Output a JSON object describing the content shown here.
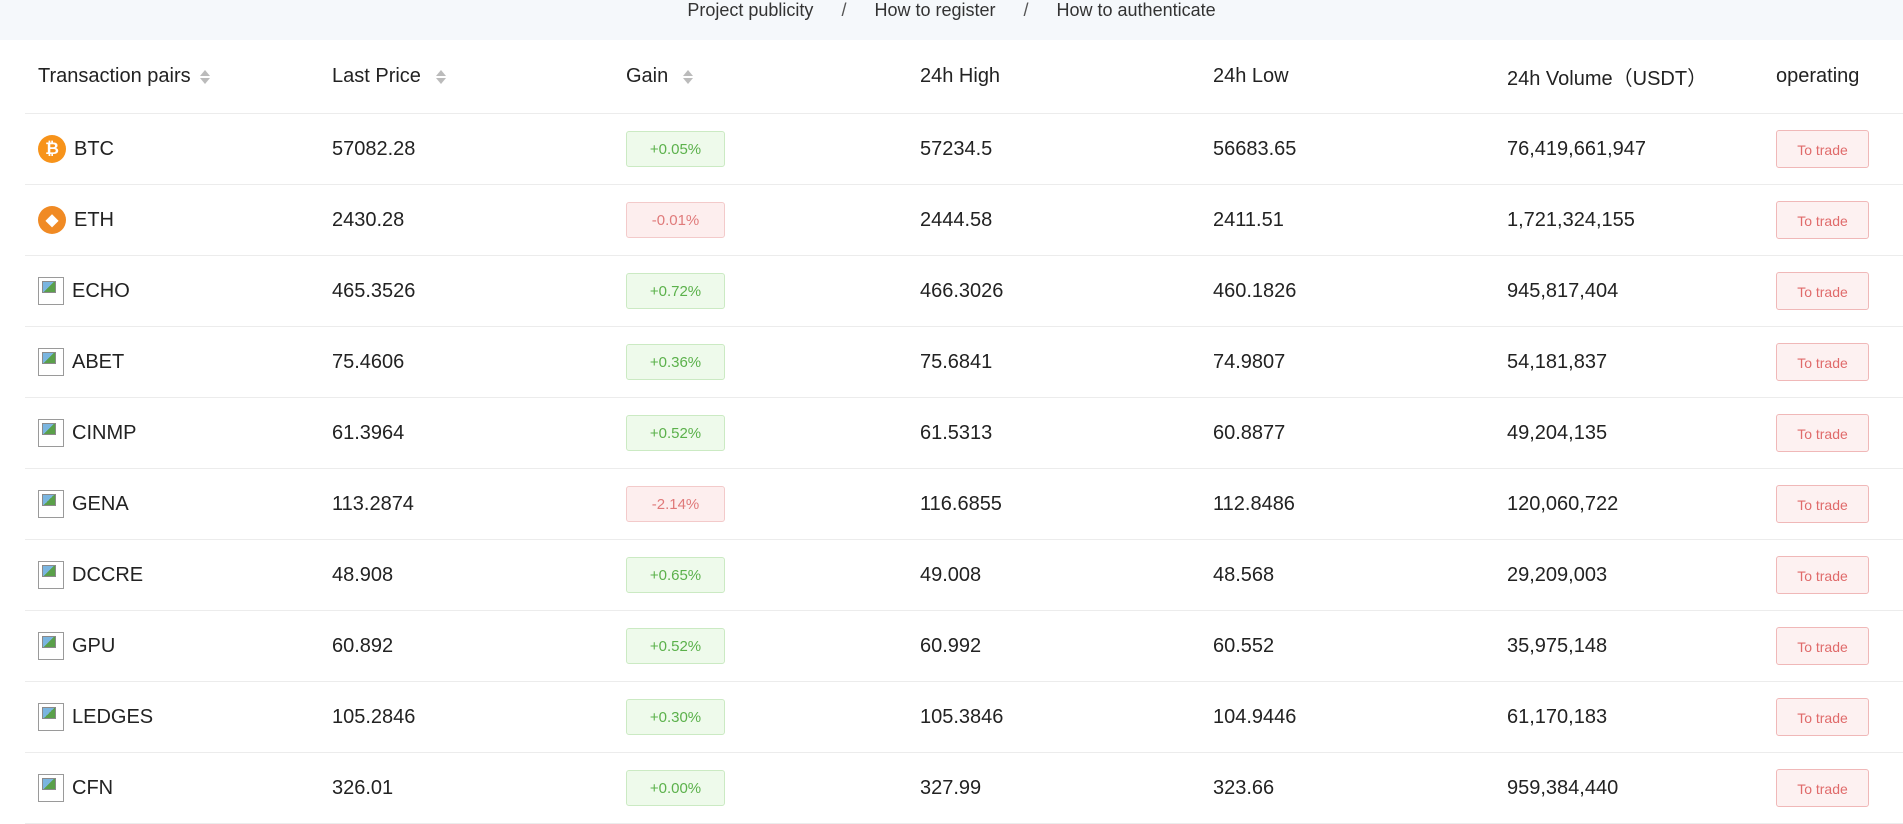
{
  "nav": {
    "links": [
      "Project publicity",
      "How to register",
      "How to authenticate"
    ],
    "separator": "/"
  },
  "table": {
    "headers": {
      "pair": "Transaction pairs",
      "last_price": "Last Price",
      "gain": "Gain",
      "high": "24h High",
      "low": "24h Low",
      "volume": "24h Volume（USDT）",
      "operating": "operating"
    },
    "rows": [
      {
        "icon": "bitcoin-icon",
        "pair": "BTC",
        "price": "57082.28",
        "gain": "+0.05%",
        "trend": "up",
        "high": "57234.5",
        "low": "56683.65",
        "volume": "76,419,661,947",
        "action": "To trade"
      },
      {
        "icon": "ethereum-icon",
        "pair": "ETH",
        "price": "2430.28",
        "gain": "-0.01%",
        "trend": "down",
        "high": "2444.58",
        "low": "2411.51",
        "volume": "1,721,324,155",
        "action": "To trade"
      },
      {
        "icon": "broken-image-icon",
        "pair": "ECHO",
        "price": "465.3526",
        "gain": "+0.72%",
        "trend": "up",
        "high": "466.3026",
        "low": "460.1826",
        "volume": "945,817,404",
        "action": "To trade"
      },
      {
        "icon": "broken-image-icon",
        "pair": "ABET",
        "price": "75.4606",
        "gain": "+0.36%",
        "trend": "up",
        "high": "75.6841",
        "low": "74.9807",
        "volume": "54,181,837",
        "action": "To trade"
      },
      {
        "icon": "broken-image-icon",
        "pair": "CINMP",
        "price": "61.3964",
        "gain": "+0.52%",
        "trend": "up",
        "high": "61.5313",
        "low": "60.8877",
        "volume": "49,204,135",
        "action": "To trade"
      },
      {
        "icon": "broken-image-icon",
        "pair": "GENA",
        "price": "113.2874",
        "gain": "-2.14%",
        "trend": "down",
        "high": "116.6855",
        "low": "112.8486",
        "volume": "120,060,722",
        "action": "To trade"
      },
      {
        "icon": "broken-image-icon",
        "pair": "DCCRE",
        "price": "48.908",
        "gain": "+0.65%",
        "trend": "up",
        "high": "49.008",
        "low": "48.568",
        "volume": "29,209,003",
        "action": "To trade"
      },
      {
        "icon": "broken-image-icon",
        "pair": "GPU",
        "price": "60.892",
        "gain": "+0.52%",
        "trend": "up",
        "high": "60.992",
        "low": "60.552",
        "volume": "35,975,148",
        "action": "To trade"
      },
      {
        "icon": "broken-image-icon",
        "pair": "LEDGES",
        "price": "105.2846",
        "gain": "+0.30%",
        "trend": "up",
        "high": "105.3846",
        "low": "104.9446",
        "volume": "61,170,183",
        "action": "To trade"
      },
      {
        "icon": "broken-image-icon",
        "pair": "CFN",
        "price": "326.01",
        "gain": "+0.00%",
        "trend": "up",
        "high": "327.99",
        "low": "323.66",
        "volume": "959,384,440",
        "action": "To trade"
      }
    ]
  }
}
